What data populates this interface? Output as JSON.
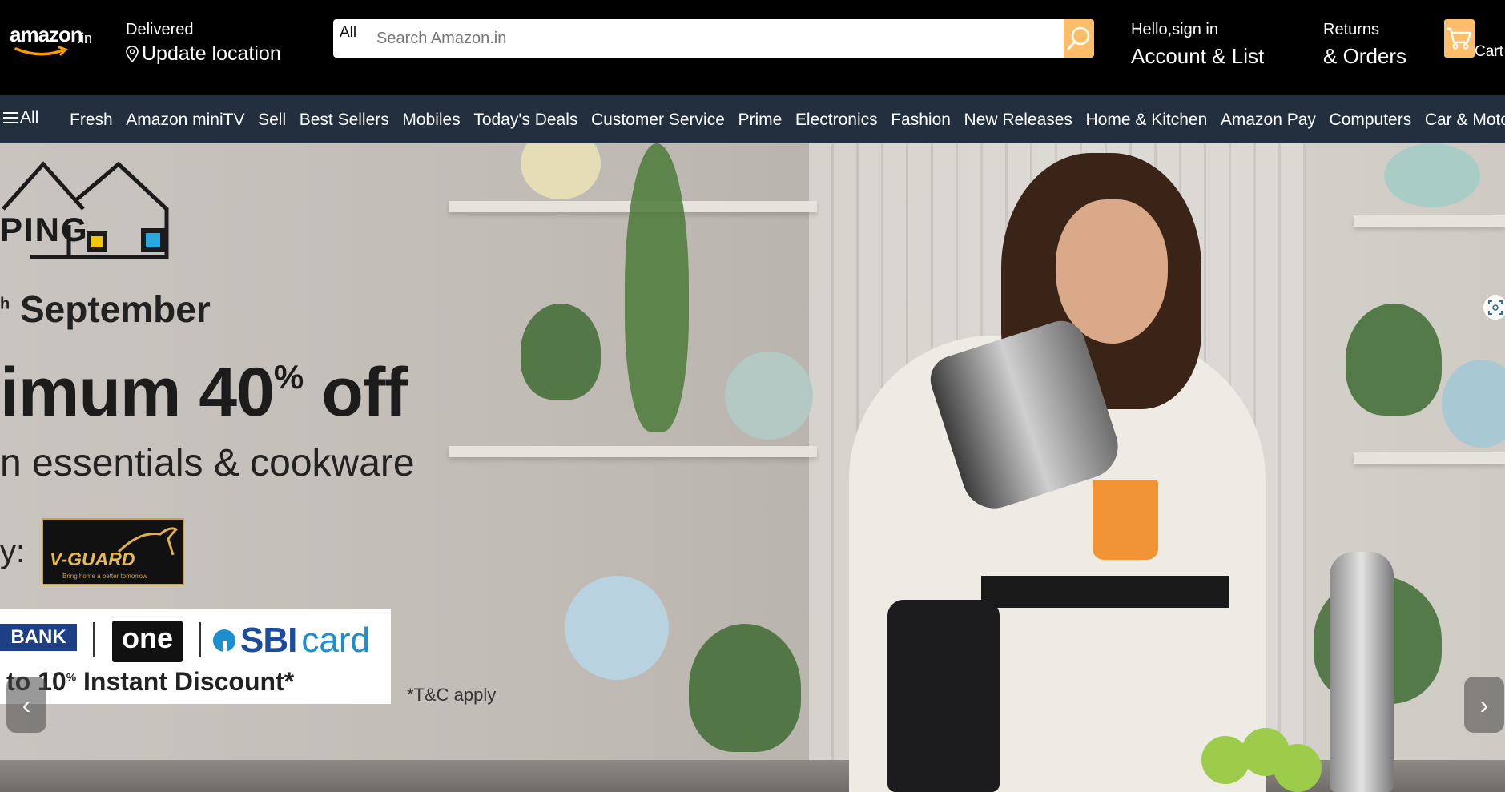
{
  "header": {
    "logo_text": "amazon",
    "logo_tld": ".in",
    "deliver_label": "Delivered",
    "location_label": "Update location",
    "search": {
      "category": "All",
      "placeholder": "Search Amazon.in",
      "value": ""
    },
    "account_greeting": "Hello,sign in",
    "account_label": "Account & List",
    "returns_label": "Returns",
    "orders_label": "& Orders",
    "cart_label": "Cart",
    "accent_color": "#febd69"
  },
  "nav": {
    "all_label": "All",
    "items": [
      "Fresh",
      "Amazon miniTV",
      "Sell",
      "Best Sellers",
      "Mobiles",
      "Today's Deals",
      "Customer Service",
      "Prime",
      "Electronics",
      "Fashion",
      "New Releases",
      "Home & Kitchen",
      "Amazon Pay",
      "Computers",
      "Car & Motorbike"
    ]
  },
  "banner": {
    "ping_text": "PING",
    "date_prefix": "h",
    "date_text": "September",
    "headline": "imum 40",
    "headline_sup": "%",
    "headline_suffix": "off",
    "subline": "n essentials & cookware",
    "by_text": "y:",
    "brand_logo_text": "V-GUARD",
    "brand_tagline": "Bring home a better tomorrow",
    "bank_label": "BANK",
    "one_label": "one",
    "sbi_label": "SBI",
    "sbi_card_label": "card",
    "discount_prefix": "to 10",
    "discount_sup": "%",
    "discount_suffix": "Instant Discount*",
    "tnc": "*T&C apply",
    "prev_glyph": "‹",
    "next_glyph": "›"
  }
}
